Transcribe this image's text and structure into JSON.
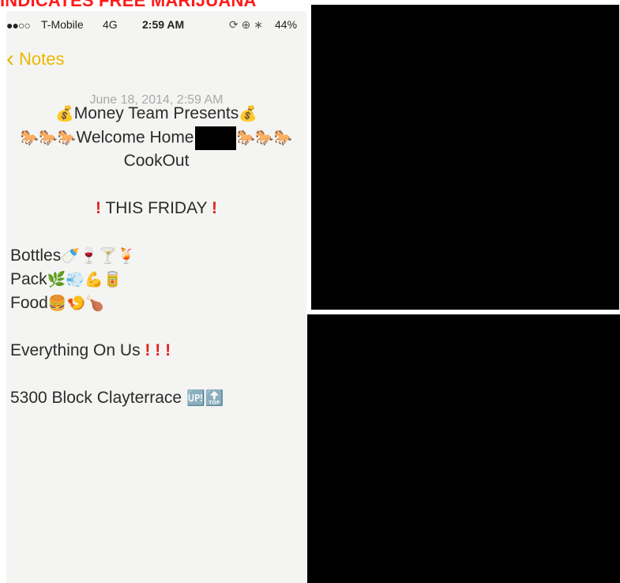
{
  "caption": "INDICATES FREE MARIJUANA",
  "status_bar": {
    "signal": "●●○○",
    "carrier": "T-Mobile",
    "network": "4G",
    "time": "2:59 AM",
    "icons": "⟳ ⊕ ∗",
    "battery": "44%"
  },
  "nav": {
    "back_label": "Notes",
    "back_icon": "chevron-left"
  },
  "note": {
    "date": "June 18, 2014, 2:59 AM",
    "line1": "Money Team Presents",
    "line2": "Welcome Home",
    "line3": "CookOut",
    "friday": "THIS FRIDAY",
    "bottles": "Bottles",
    "pack": "Pack",
    "food": "Food",
    "everything": "Everything On Us",
    "address": "5300 Block Clayterrace"
  },
  "emoji": {
    "moneybag": "💰",
    "horse": "🐎",
    "bang": "!",
    "bottles": "🍼🍷🍸🍹",
    "pack": "🌿💨💪🥫",
    "food": "🍔🍤🍗",
    "address": "🆙🔝"
  },
  "colors": {
    "caption": "#ff1a1a",
    "accent": "#e9b800",
    "redaction": "#000000"
  }
}
